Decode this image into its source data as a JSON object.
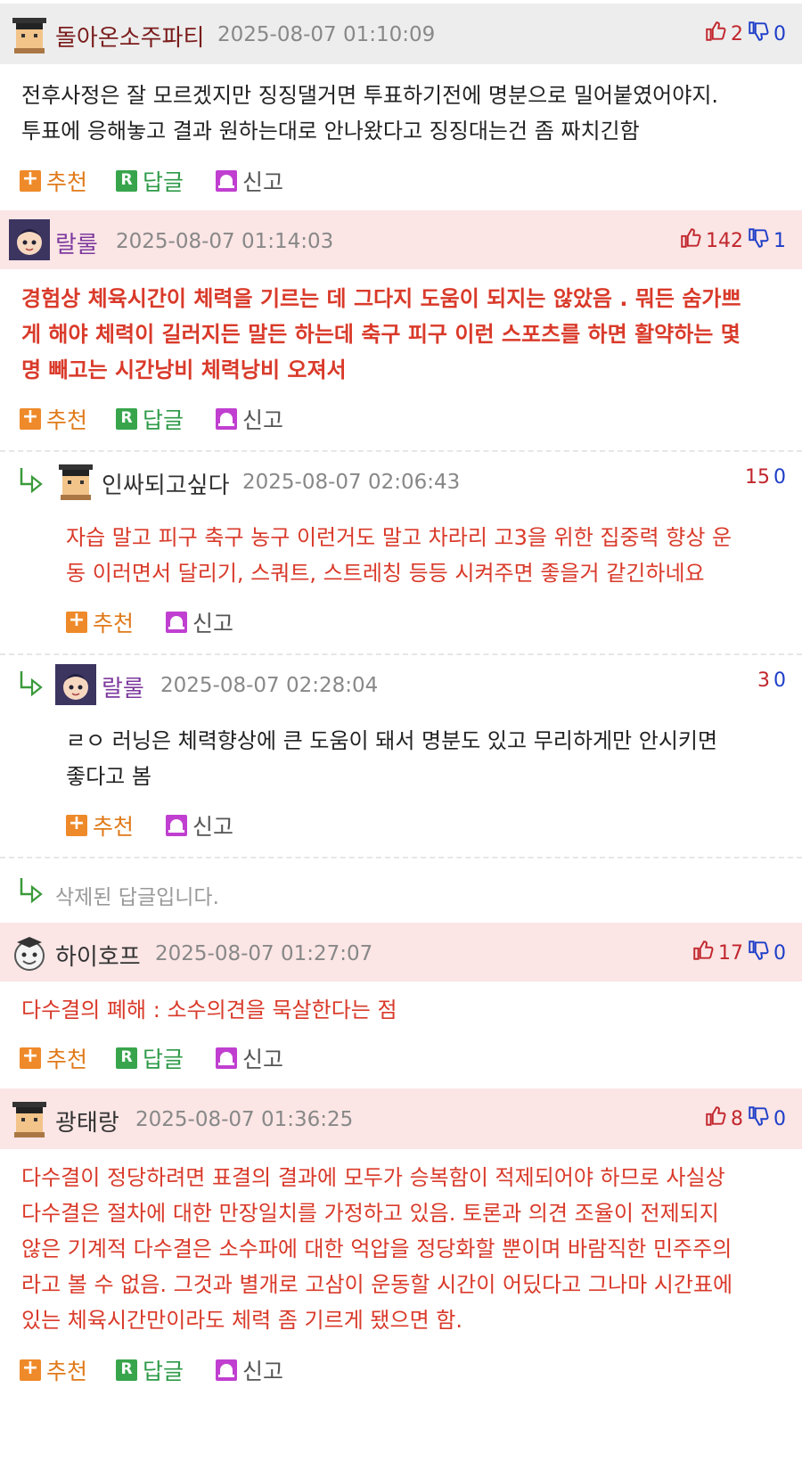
{
  "comments": [
    {
      "name": "돌아온소주파티",
      "date": "2025-08-07 01:10:09",
      "up": "2",
      "down": "0",
      "lines": [
        "전후사정은 잘 모르겠지만 징징댈거면 투표하기전에 명분으로 밀어붙였어야지.",
        "투표에 응해놓고 결과 원하는대로 안나왔다고 징징대는건 좀 짜치긴함"
      ],
      "actions": {
        "recommend": "추천",
        "reply": "답글",
        "report": "신고"
      }
    },
    {
      "name": "랄룰",
      "date": "2025-08-07 01:14:03",
      "up": "142",
      "down": "1",
      "lines": [
        "경험상 체육시간이 체력을 기르는 데 그다지 도움이 되지는 않았음 . 뭐든 숨가쁘",
        "게 해야 체력이 길러지든 말든 하는데 축구 피구 이런 스포츠를 하면 활약하는 몇",
        "명 빼고는 시간낭비 체력낭비 오져서"
      ],
      "actions": {
        "recommend": "추천",
        "reply": "답글",
        "report": "신고"
      }
    },
    {
      "name": "하이호프",
      "date": "2025-08-07 01:27:07",
      "up": "17",
      "down": "0",
      "lines": [
        "다수결의 폐해 : 소수의견을 묵살한다는 점"
      ],
      "actions": {
        "recommend": "추천",
        "reply": "답글",
        "report": "신고"
      }
    },
    {
      "name": "광태랑",
      "date": "2025-08-07 01:36:25",
      "up": "8",
      "down": "0",
      "lines": [
        "다수결이 정당하려면 표결의 결과에 모두가 승복함이 적제되어야 하므로 사실상",
        "다수결은 절차에 대한 만장일치를 가정하고 있음. 토론과 의견 조율이 전제되지",
        "않은 기계적 다수결은 소수파에 대한 억압을 정당화할 뿐이며 바람직한 민주주의",
        "라고 볼 수 없음. 그것과 별개로 고삼이 운동할 시간이 어딨다고 그나마 시간표에",
        "있는 체육시간만이라도 체력 좀 기르게 됐으면 함."
      ],
      "actions": {
        "recommend": "추천",
        "reply": "답글",
        "report": "신고"
      }
    }
  ],
  "replies": [
    {
      "name": "인싸되고싶다",
      "date": "2025-08-07 02:06:43",
      "up": "15",
      "down": "0",
      "lines": [
        "자습 말고 피구 축구 농구 이런거도 말고 차라리 고3을 위한 집중력 향상 운",
        "동 이러면서 달리기, 스쿼트, 스트레칭 등등 시켜주면 좋을거 같긴하네요"
      ],
      "actions": {
        "recommend": "추천",
        "report": "신고"
      }
    },
    {
      "name": "랄룰",
      "date": "2025-08-07 02:28:04",
      "up": "3",
      "down": "0",
      "lines": [
        "ㄹㅇ 러닝은 체력향상에 큰 도움이 돼서 명분도 있고 무리하게만 안시키면",
        "좋다고 봄"
      ],
      "actions": {
        "recommend": "추천",
        "report": "신고"
      }
    }
  ],
  "deleted_reply": "삭제된 답글입니다.",
  "colors": {
    "header_gray": "#ededed",
    "header_pink": "#fbe5e5",
    "red_text": "#d93a2a",
    "up": "#c1272d",
    "down": "#1e3ec8"
  }
}
